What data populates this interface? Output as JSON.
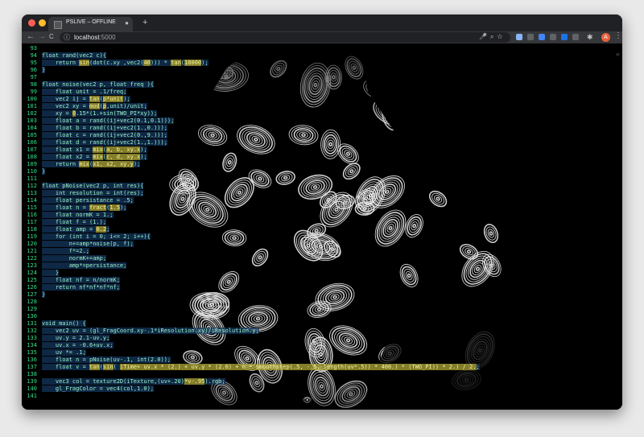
{
  "browser": {
    "tab_title": "PSLIVE – OFFLINE",
    "tab_close": "●",
    "new_tab": "+",
    "url_host": "localhost",
    "url_port": ":5000",
    "avatar_letter": "A"
  },
  "icons": {
    "back": "←",
    "forward": "→",
    "reload": "C",
    "info": "ⓘ",
    "mic": "🎤",
    "zoom": "⌕",
    "star": "☆",
    "puzzle": "✱",
    "menu": "⋮",
    "collapse": "«",
    "eye": "👁"
  },
  "colors": {
    "line_numbers": "#2fe08a",
    "code_text": "#9df2c8",
    "highlight": "#afa537"
  },
  "code": [
    {
      "n": "93",
      "segs": []
    },
    {
      "n": "94",
      "segs": [
        {
          "t": "float rand(vec2 c){"
        }
      ]
    },
    {
      "n": "95",
      "segs": [
        {
          "t": "    return "
        },
        {
          "t": "sin",
          "h": 1
        },
        {
          "t": "(dot(c.xy ,vec2("
        },
        {
          "t": "40",
          "h": 1
        },
        {
          "t": "))) * "
        },
        {
          "t": "tan",
          "h": 1
        },
        {
          "t": "("
        },
        {
          "t": "18000",
          "h": 1
        },
        {
          "t": ");"
        }
      ]
    },
    {
      "n": "96",
      "segs": [
        {
          "t": "}"
        }
      ]
    },
    {
      "n": "97",
      "segs": []
    },
    {
      "n": "98",
      "segs": [
        {
          "t": "float noise(vec2 p, float freq ){"
        }
      ]
    },
    {
      "n": "99",
      "segs": [
        {
          "t": "    float unit = .1/freq;"
        }
      ]
    },
    {
      "n": "100",
      "segs": [
        {
          "t": "    vec2 ij = "
        },
        {
          "t": "tan",
          "h": 1
        },
        {
          "t": "("
        },
        {
          "t": "p*unit",
          "h": 1
        },
        {
          "t": ");"
        }
      ]
    },
    {
      "n": "101",
      "segs": [
        {
          "t": "    vec2 xy = "
        },
        {
          "t": "mod",
          "h": 1
        },
        {
          "t": "("
        },
        {
          "t": "p",
          "h": 1
        },
        {
          "t": ",unit)/unit;"
        }
      ]
    },
    {
      "n": "102",
      "segs": [
        {
          "t": "    xy = "
        },
        {
          "t": "0",
          "h": 1
        },
        {
          "t": ".15*(1.+sin(TWO_PI*xy));"
        }
      ]
    },
    {
      "n": "103",
      "segs": [
        {
          "t": "    float a = rand((ij+vec2(0.1,0.1)));"
        }
      ]
    },
    {
      "n": "104",
      "segs": [
        {
          "t": "    float b = rand((ij+vec2(1.,0.)));"
        }
      ]
    },
    {
      "n": "105",
      "segs": [
        {
          "t": "    float c = rand((ij+vec2(0.,9.)));"
        }
      ]
    },
    {
      "n": "106",
      "segs": [
        {
          "t": "    float d = rand((ij+vec2(1.,1.)));"
        }
      ]
    },
    {
      "n": "107",
      "segs": [
        {
          "t": "    float x1 = "
        },
        {
          "t": "mix",
          "h": 1
        },
        {
          "t": "("
        },
        {
          "t": "a, b, xy.x",
          "h": 1
        },
        {
          "t": ");"
        }
      ]
    },
    {
      "n": "108",
      "segs": [
        {
          "t": "    float x2 = "
        },
        {
          "t": "mix",
          "h": 1
        },
        {
          "t": "("
        },
        {
          "t": "c, d, xy.x",
          "h": 1
        },
        {
          "t": ");"
        }
      ]
    },
    {
      "n": "109",
      "segs": [
        {
          "t": "    return "
        },
        {
          "t": "mix",
          "h": 1
        },
        {
          "t": "("
        },
        {
          "t": "x1, x2, xy.y",
          "h": 1
        },
        {
          "t": ");"
        }
      ]
    },
    {
      "n": "110",
      "segs": [
        {
          "t": "}"
        }
      ]
    },
    {
      "n": "111",
      "segs": []
    },
    {
      "n": "112",
      "segs": [
        {
          "t": "float pNoise(vec2 p, int res){"
        }
      ]
    },
    {
      "n": "113",
      "segs": [
        {
          "t": "    int resolution = int(res);"
        }
      ]
    },
    {
      "n": "114",
      "segs": [
        {
          "t": "    float persistance = .5;"
        }
      ]
    },
    {
      "n": "115",
      "segs": [
        {
          "t": "    float n = "
        },
        {
          "t": "fract",
          "h": 1
        },
        {
          "t": "("
        },
        {
          "t": "1.5",
          "h": 1
        },
        {
          "t": ");"
        }
      ]
    },
    {
      "n": "116",
      "segs": [
        {
          "t": "    float normK = 1.;"
        }
      ]
    },
    {
      "n": "117",
      "segs": [
        {
          "t": "    float f = (1.);"
        }
      ]
    },
    {
      "n": "118",
      "segs": [
        {
          "t": "    float amp = "
        },
        {
          "t": "0.2",
          "h": 1
        },
        {
          "t": ";"
        }
      ]
    },
    {
      "n": "119",
      "segs": [
        {
          "t": "    for (int i = 0; i<= 2; i++){"
        }
      ]
    },
    {
      "n": "120",
      "segs": [
        {
          "t": "        n+=amp*noise(p, f);"
        }
      ]
    },
    {
      "n": "121",
      "segs": [
        {
          "t": "        f*=2.;"
        }
      ]
    },
    {
      "n": "122",
      "segs": [
        {
          "t": "        normK+=amp;"
        }
      ]
    },
    {
      "n": "123",
      "segs": [
        {
          "t": "        amp*=persistance;"
        }
      ]
    },
    {
      "n": "124",
      "segs": [
        {
          "t": "    }"
        }
      ]
    },
    {
      "n": "125",
      "segs": [
        {
          "t": "    float nf = n/normK;"
        }
      ]
    },
    {
      "n": "126",
      "segs": [
        {
          "t": "    return nf*nf*nf*nf;"
        }
      ]
    },
    {
      "n": "127",
      "segs": [
        {
          "t": "}"
        }
      ]
    },
    {
      "n": "128",
      "segs": []
    },
    {
      "n": "129",
      "segs": []
    },
    {
      "n": "130",
      "segs": []
    },
    {
      "n": "131",
      "segs": [
        {
          "t": "void main() {"
        }
      ]
    },
    {
      "n": "132",
      "segs": [
        {
          "t": "    vec2 uv = (gl_FragCoord.xy-.1*iResolution.xy)/iResolution.y;"
        }
      ]
    },
    {
      "n": "133",
      "segs": [
        {
          "t": "    uv.y = 2.1-uv.y;"
        }
      ]
    },
    {
      "n": "134",
      "segs": [
        {
          "t": "    uv.x = -0.6+uv.x;"
        }
      ]
    },
    {
      "n": "135",
      "segs": [
        {
          "t": "    uv *= .1;"
        }
      ]
    },
    {
      "n": "136",
      "segs": [
        {
          "t": "    float n = pNoise(uv-.1, int(2.0));"
        }
      ]
    },
    {
      "n": "137",
      "segs": [
        {
          "t": "    float v = "
        },
        {
          "t": "tan",
          "h": 1
        },
        {
          "t": "("
        },
        {
          "t": "sin",
          "h": 1
        },
        {
          "t": "( "
        },
        {
          "t": "iTime+ uv.x * (2.) + uv.y * (2.0) + n * smoothstep(.5, -.5, length(uv*.5)) * 400.) * (TWO_PI)) * 2.) / 2.",
          "h": 1
        },
        {
          "t": ";"
        }
      ]
    },
    {
      "n": "138",
      "segs": []
    },
    {
      "n": "139",
      "segs": [
        {
          "t": "    vec3 col = texture2D(iTexture,(uv+.20)"
        },
        {
          "t": "*v-.95",
          "h": 1
        },
        {
          "t": ").rgb;"
        }
      ]
    },
    {
      "n": "140",
      "segs": [
        {
          "t": "    gl_FragColor = vec4(col,1.0);"
        }
      ]
    },
    {
      "n": "141",
      "segs": []
    }
  ]
}
